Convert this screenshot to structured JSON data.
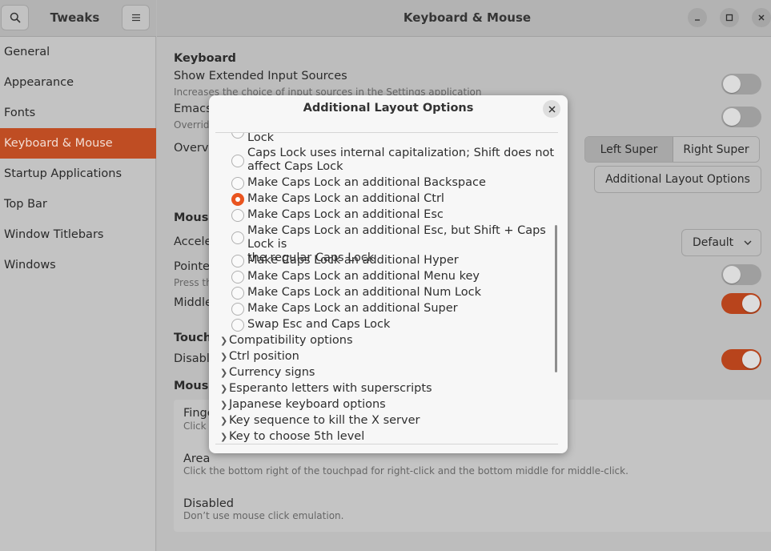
{
  "left_header": {
    "title": "Tweaks"
  },
  "nav": [
    {
      "label": "General"
    },
    {
      "label": "Appearance"
    },
    {
      "label": "Fonts"
    },
    {
      "label": "Keyboard & Mouse",
      "active": true
    },
    {
      "label": "Startup Applications"
    },
    {
      "label": "Top Bar"
    },
    {
      "label": "Window Titlebars"
    },
    {
      "label": "Windows"
    }
  ],
  "window": {
    "title": "Keyboard & Mouse"
  },
  "keyboard": {
    "heading": "Keyboard",
    "extended_label": "Show Extended Input Sources",
    "extended_sub": "Increases the choice of input sources in the Settings application",
    "emacs_label": "Emacs",
    "emacs_sub": "Overrid",
    "overview_label": "Overvi",
    "super_left": "Left Super",
    "super_right": "Right Super",
    "additional_button": "Additional Layout Options"
  },
  "mouse": {
    "heading": "Mouse",
    "accel_label": "Accele",
    "accel_value": "Default",
    "pointer_label": "Pointe",
    "pointer_sub": "Press th",
    "middle_label": "Middle"
  },
  "touchpad": {
    "heading": "Touch",
    "disable_label": "Disabl"
  },
  "click": {
    "heading": "Mouse",
    "fingers_label": "Finge",
    "fingers_sub": "Click",
    "area_label": "Area",
    "area_sub": "Click the bottom right of the touchpad for right-click and the bottom middle for middle-click.",
    "disabled_label": "Disabled",
    "disabled_sub": "Don’t use mouse click emulation."
  },
  "toggles": {
    "extended": false,
    "emacs": false,
    "pointer": false,
    "middle": true,
    "disable_touch": true
  },
  "dialog": {
    "title": "Additional Layout Options",
    "partial_item": "Lock",
    "options": [
      {
        "label": "Caps Lock uses internal capitalization; Shift does not",
        "label2": "affect Caps Lock"
      },
      {
        "label": "Make Caps Lock an additional Backspace"
      },
      {
        "label": "Make Caps Lock an additional Ctrl",
        "checked": true
      },
      {
        "label": "Make Caps Lock an additional Esc"
      },
      {
        "label": "Make Caps Lock an additional Esc, but Shift + Caps Lock is",
        "label2": "the regular Caps Lock"
      },
      {
        "label": "Make Caps Lock an additional Hyper"
      },
      {
        "label": "Make Caps Lock an additional Menu key"
      },
      {
        "label": "Make Caps Lock an additional Num Lock"
      },
      {
        "label": "Make Caps Lock an additional Super"
      },
      {
        "label": "Swap Esc and Caps Lock"
      }
    ],
    "categories": [
      {
        "label": "Compatibility options"
      },
      {
        "label": "Ctrl position"
      },
      {
        "label": "Currency signs"
      },
      {
        "label": "Esperanto letters with superscripts"
      },
      {
        "label": "Japanese keyboard options"
      },
      {
        "label": "Key sequence to kill the X server"
      },
      {
        "label": "Key to choose 5th level"
      }
    ]
  },
  "colors": {
    "accent": "#e9541f",
    "accent_dim": "#bf4d23"
  }
}
